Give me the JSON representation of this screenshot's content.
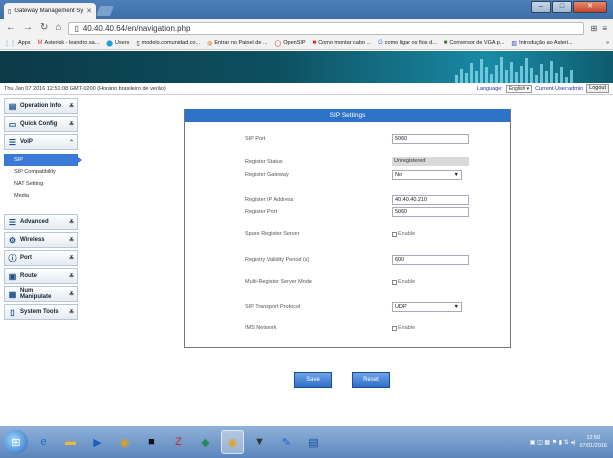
{
  "browser": {
    "tab_title": "Gateway Management Sy",
    "tab_close": "✕",
    "url": "40.40.40.64/en/navigation.php",
    "bookmarks": [
      {
        "icon": "apps-icon",
        "label": "Apps"
      },
      {
        "icon": "gmail-icon",
        "label": "Asterisk - leandro.sa..."
      },
      {
        "icon": "skype-icon",
        "label": "Users"
      },
      {
        "icon": "doc-icon",
        "label": "modelo.comunidad.co..."
      },
      {
        "icon": "panel-icon",
        "label": "Entrar no Painel de ..."
      },
      {
        "icon": "opensip-icon",
        "label": "OpenSIP"
      },
      {
        "icon": "youtube-icon",
        "label": "Como montar cabo ..."
      },
      {
        "icon": "google-icon",
        "label": "como ligar os fios d..."
      },
      {
        "icon": "vga-icon",
        "label": "Conversor de VGA p..."
      },
      {
        "icon": "book-icon",
        "label": "Introdução ao Asteri..."
      }
    ]
  },
  "status": {
    "datetime": "Thu Jan 07 2016 12:51:08 GMT-0200 (Horário brasileiro de verão)",
    "language_label": "Language:",
    "language_value": "English",
    "current_user_label": "Current User:admin",
    "logout_label": "Logout"
  },
  "sidebar": {
    "menus_top": [
      {
        "name": "operation-info",
        "icon": "▤",
        "label": "Operation Info"
      },
      {
        "name": "quick-config",
        "icon": "▭",
        "label": "Quick Config"
      },
      {
        "name": "voip",
        "icon": "☰",
        "label": "VoIP"
      }
    ],
    "submenu": [
      "SIP",
      "SIP Compatibility",
      "NAT Setting",
      "Media"
    ],
    "menus_bottom": [
      {
        "name": "advanced",
        "icon": "☰",
        "label": "Advanced"
      },
      {
        "name": "wireless",
        "icon": "⚙",
        "label": "Wireless"
      },
      {
        "name": "port",
        "icon": "ⓘ",
        "label": "Port"
      },
      {
        "name": "route",
        "icon": "▣",
        "label": "Route"
      },
      {
        "name": "num-manipulate",
        "icon": "▦",
        "label": "Num Manipulate"
      },
      {
        "name": "system-tools",
        "icon": "▯",
        "label": "System Tools"
      }
    ]
  },
  "sip_settings": {
    "title": "SIP Settings",
    "sip_port_label": "SIP Port",
    "sip_port_value": "5060",
    "register_status_label": "Register Status",
    "register_status_value": "Unregistered",
    "register_gateway_label": "Register Gateway",
    "register_gateway_value": "No",
    "register_ip_label": "Register IP Address",
    "register_ip_value": "40.40.40.210",
    "register_port_label": "Register Port",
    "register_port_value": "5060",
    "spare_server_label": "Spare Register Server",
    "spare_server_check": "Enable",
    "validity_label": "Registry Validity Period (s)",
    "validity_value": "600",
    "multi_server_label": "Multi-Register Server Mode",
    "multi_server_check": "Enable",
    "transport_label": "SIP Transport Protocol",
    "transport_value": "UDP",
    "ims_label": "IMS Network",
    "ims_check": "Enable"
  },
  "buttons": {
    "save": "Save",
    "reset": "Reset"
  },
  "taskbar": {
    "time": "12:50",
    "date": "07/01/2016"
  }
}
